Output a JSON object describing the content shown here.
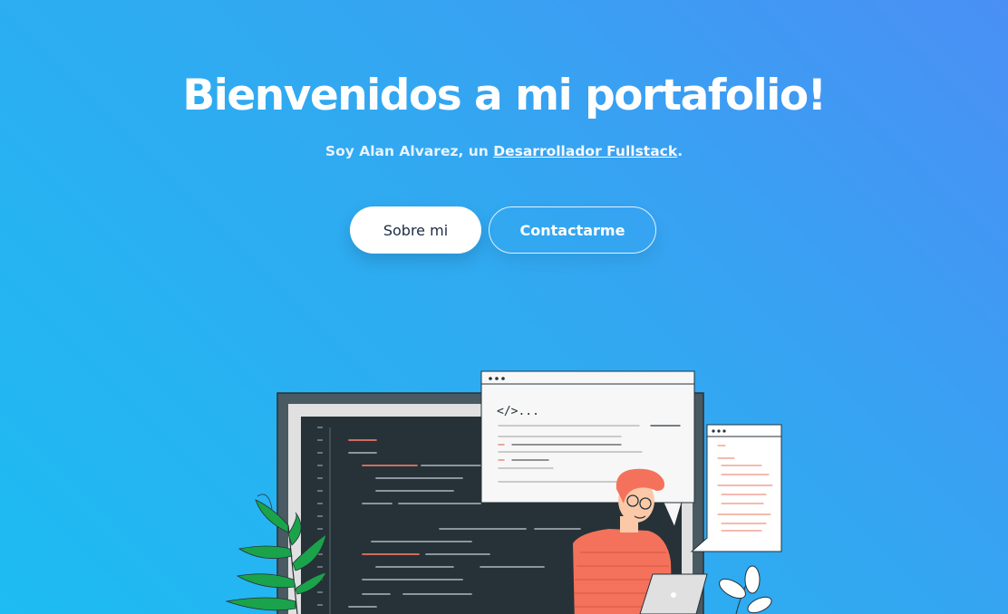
{
  "hero": {
    "title": "Bienvenidos a mi portafolio!",
    "subtitle_prefix": "Soy Alan Alvarez, un ",
    "subtitle_link": "Desarrollador Fullstack",
    "subtitle_suffix": ".",
    "primary_button": "Sobre mi",
    "secondary_button": "Contactarme"
  },
  "illustration": {
    "code_window_text": "</>...",
    "colors": {
      "monitor": "#263238",
      "window_bg": "#f5f5f5",
      "code_red": "#e87461",
      "person_shirt": "#f4725b",
      "person_hair": "#f4725b",
      "plant": "#1aa34a"
    }
  }
}
